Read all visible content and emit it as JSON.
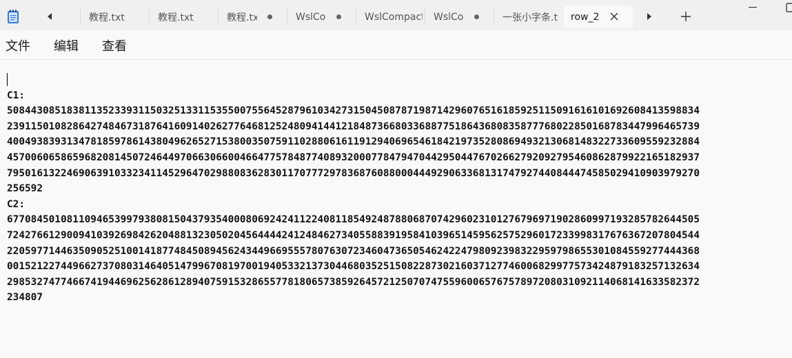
{
  "tabs": [
    {
      "label": "教程.txt",
      "modified": false
    },
    {
      "label": "教程.txt",
      "modified": false
    },
    {
      "label": "教程.tx",
      "modified": true
    },
    {
      "label": "WslCo",
      "modified": true
    },
    {
      "label": "WslCompact",
      "modified": false
    },
    {
      "label": "WslCo",
      "modified": true
    },
    {
      "label": "一张小字条.t",
      "modified": false
    },
    {
      "label": "row_2",
      "modified": false,
      "active": true
    }
  ],
  "menu": {
    "file": "文件",
    "edit": "编辑",
    "view": "查看"
  },
  "icons": {
    "app": "notepad-icon",
    "scroll_left": "chevron-left-icon",
    "scroll_right": "chevron-right-icon",
    "close_tab": "close-icon",
    "new_tab": "plus-icon",
    "minimize": "minimize-icon",
    "maximize": "maximize-icon"
  },
  "document": {
    "lines": [
      "C1:",
      "50844308518381135233931150325133115355007556452879610342731504508787198714296076516185925115091616101692608413598834",
      "23911501082864274846731876416091402627764681252480941441218487366803368877518643680835877768022850168783447996465739",
      "40049383931347818597861438049626527153800350759110288061611912940696546184219735280869493213068148322733609559232884",
      "45700606586596820814507246449706630660046647757848774089320007784794704429504476702662792092795460862879922165182937",
      "79501613224690639103323411452964702988083628301170777297836876088000444929063368131747927440844474585029410903979270",
      "256592",
      "C2:",
      "67708450108110946539979380815043793540008069242411224081185492487880687074296023101276796971902860997193285782644505",
      "72427661290094103926984262048813230502045644442412484627340558839195841039651459562575296017233998317676367207804544",
      "22059771446350905251001418774845089456243449669555780763072346047365054624224798092398322959798655301084559277444368",
      "00152122744966273708031464051479967081970019405332137304468035251508228730216037127746006829977573424879183257132634",
      "29853274774667419446962562861289407591532865577818065738592645721250707475596006576757897208031092114068141633582372",
      "234807"
    ]
  }
}
